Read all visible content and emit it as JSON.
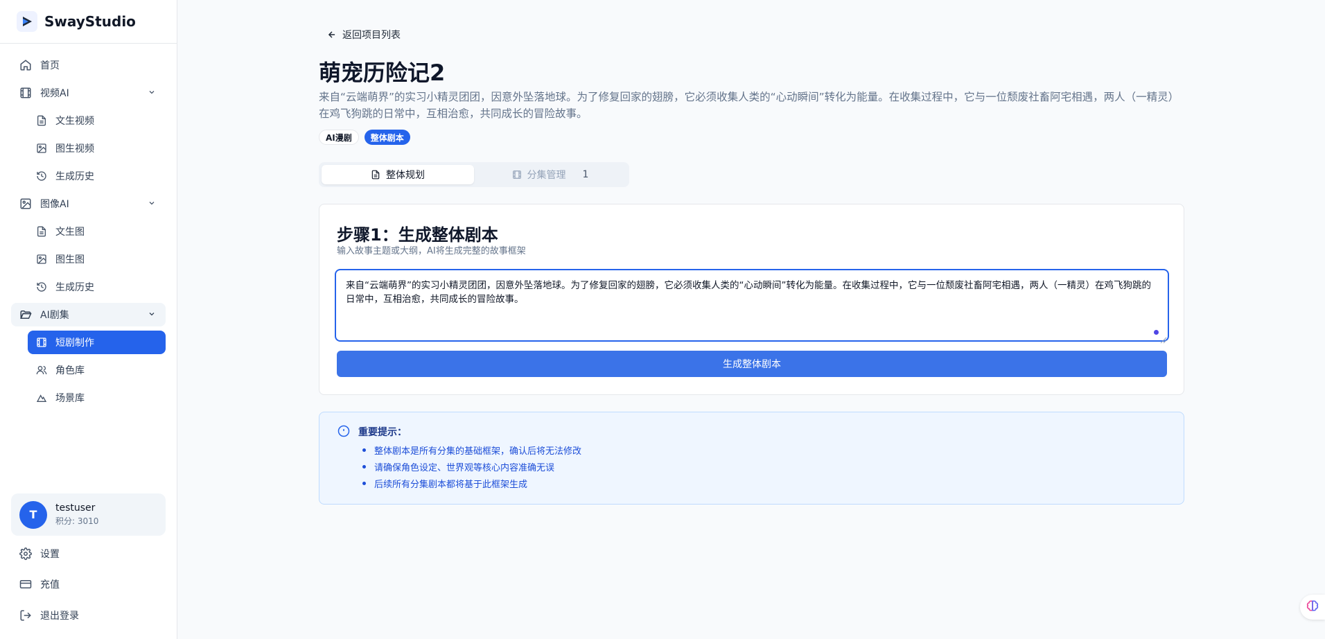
{
  "app": {
    "name": "SwayStudio"
  },
  "sidebar": {
    "items": [
      {
        "label": "首页"
      },
      {
        "label": "视频AI"
      },
      {
        "label": "文生视频"
      },
      {
        "label": "图生视频"
      },
      {
        "label": "生成历史"
      },
      {
        "label": "图像AI"
      },
      {
        "label": "文生图"
      },
      {
        "label": "图生图"
      },
      {
        "label": "生成历史"
      },
      {
        "label": "AI剧集"
      },
      {
        "label": "短剧制作"
      },
      {
        "label": "角色库"
      },
      {
        "label": "场景库"
      }
    ],
    "user": {
      "initial": "T",
      "name": "testuser",
      "points": "积分: 3010"
    },
    "bottom": [
      {
        "label": "设置"
      },
      {
        "label": "充值"
      },
      {
        "label": "退出登录"
      }
    ]
  },
  "main": {
    "back_label": "返回项目列表",
    "title": "萌宠历险记2",
    "description": "来自“云端萌界”的实习小精灵团团，因意外坠落地球。为了修复回家的翅膀，它必须收集人类的“心动瞬间”转化为能量。在收集过程中，它与一位颓废社畜阿宅相遇，两人（一精灵）在鸡飞狗跳的日常中，互相治愈，共同成长的冒险故事。",
    "tags": [
      "AI漫剧",
      "整体剧本"
    ],
    "tabs": [
      {
        "label": "整体规划"
      },
      {
        "label": "分集管理",
        "count": "1"
      }
    ],
    "step": {
      "title": "步骤1：生成整体剧本",
      "subtitle": "输入故事主题或大纲，AI将生成完整的故事框架",
      "input_value": "来自“云端萌界”的实习小精灵团团，因意外坠落地球。为了修复回家的翅膀，它必须收集人类的“心动瞬间”转化为能量。在收集过程中，它与一位颓废社畜阿宅相遇，两人（一精灵）在鸡飞狗跳的日常中，互相治愈，共同成长的冒险故事。",
      "button_label": "生成整体剧本"
    },
    "notice": {
      "title": "重要提示：",
      "items": [
        "整体剧本是所有分集的基础框架，确认后将无法修改",
        "请确保角色设定、世界观等核心内容准确无误",
        "后续所有分集剧本都将基于此框架生成"
      ]
    }
  },
  "colors": {
    "accent": "#2563eb",
    "notice_bg": "#eff6ff",
    "notice_text": "#1d4ed8"
  }
}
